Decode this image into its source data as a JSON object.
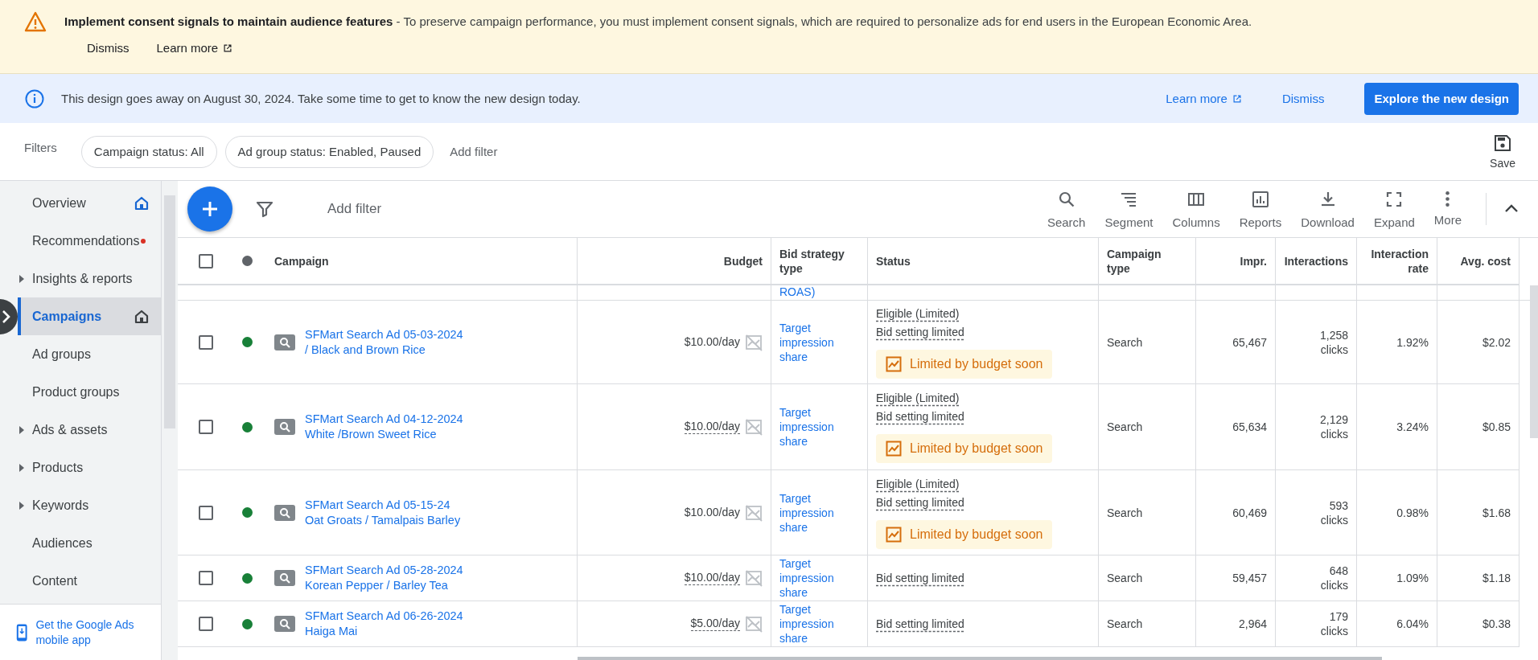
{
  "consent_banner": {
    "message": "**Implement consent signals to maintain audience features** - To preserve campaign performance, you must implement consent signals, which are required to personalize ads for end users in the European Economic Area.",
    "dismiss": "Dismiss",
    "learn_more": "Learn more"
  },
  "design_banner": {
    "message": "This design goes away on August 30, 2024. Take some time to get to know the new design today.",
    "learn_more": "Learn more",
    "dismiss": "Dismiss",
    "primary": "Explore the new design"
  },
  "filters": {
    "label": "Filters",
    "chips": [
      "Campaign status: All",
      "Ad group status: Enabled, Paused"
    ],
    "add_filter": "Add filter",
    "save": "Save"
  },
  "sidebar": {
    "items": [
      {
        "label": "Overview",
        "selected": false,
        "expandable": false,
        "notification": false,
        "home_icon": true
      },
      {
        "label": "Recommendations",
        "selected": false,
        "expandable": false,
        "notification": true,
        "home_icon": false
      },
      {
        "label": "Insights & reports",
        "selected": false,
        "expandable": true,
        "notification": false,
        "home_icon": false
      },
      {
        "label": "Campaigns",
        "selected": true,
        "expandable": false,
        "notification": false,
        "home_icon": true
      },
      {
        "label": "Ad groups",
        "selected": false,
        "expandable": false,
        "notification": false,
        "home_icon": false
      },
      {
        "label": "Product groups",
        "selected": false,
        "expandable": false,
        "notification": false,
        "home_icon": false
      },
      {
        "label": "Ads & assets",
        "selected": false,
        "expandable": true,
        "notification": false,
        "home_icon": false
      },
      {
        "label": "Products",
        "selected": false,
        "expandable": true,
        "notification": false,
        "home_icon": false
      },
      {
        "label": "Keywords",
        "selected": false,
        "expandable": true,
        "notification": false,
        "home_icon": false
      },
      {
        "label": "Audiences",
        "selected": false,
        "expandable": false,
        "notification": false,
        "home_icon": false
      },
      {
        "label": "Content",
        "selected": false,
        "expandable": false,
        "notification": false,
        "home_icon": false
      }
    ],
    "app_promo": "Get the Google Ads mobile app"
  },
  "toolbar": {
    "add_filter": "Add filter",
    "actions": [
      {
        "kind": "search",
        "label": "Search"
      },
      {
        "kind": "segment",
        "label": "Segment"
      },
      {
        "kind": "columns",
        "label": "Columns"
      },
      {
        "kind": "reports",
        "label": "Reports"
      },
      {
        "kind": "download",
        "label": "Download"
      },
      {
        "kind": "expand",
        "label": "Expand"
      },
      {
        "kind": "more",
        "label": "More"
      }
    ]
  },
  "table": {
    "columns": [
      "Campaign",
      "Budget",
      "Bid strategy type",
      "Status",
      "Campaign type",
      "Impr.",
      "Interactions",
      "Interaction rate",
      "Avg. cost"
    ],
    "select_all_checked": false,
    "partial_row": {
      "bid_strategy": "ROAS)"
    },
    "rows": [
      {
        "checked": false,
        "color": "#188038",
        "campaign": "SFMart Search Ad 05-03-2024\n/ Black and Brown Rice",
        "budget": "$10.00/day",
        "budget_dashed": false,
        "bid_strategy": "Target\nimpression\nshare",
        "statuses": [
          "Eligible (Limited)",
          "Bid setting limited"
        ],
        "badge": "Limited by budget soon",
        "type": "Search",
        "impr": "65,467",
        "interactions": "1,258\nclicks",
        "rate": "1.92%",
        "avg_cost": "$2.02"
      },
      {
        "checked": false,
        "color": "#188038",
        "campaign": "SFMart Search Ad 04-12-2024\nWhite /Brown Sweet Rice",
        "budget": "$10.00/day",
        "budget_dashed": true,
        "bid_strategy": "Target\nimpression\nshare",
        "statuses": [
          "Eligible (Limited)",
          "Bid setting limited"
        ],
        "badge": "Limited by budget soon",
        "type": "Search",
        "impr": "65,634",
        "interactions": "2,129\nclicks",
        "rate": "3.24%",
        "avg_cost": "$0.85"
      },
      {
        "checked": false,
        "color": "#188038",
        "campaign": "SFMart Search Ad 05-15-24\nOat Groats / Tamalpais Barley",
        "budget": "$10.00/day",
        "budget_dashed": false,
        "bid_strategy": "Target\nimpression\nshare",
        "statuses": [
          "Eligible (Limited)",
          "Bid setting limited"
        ],
        "badge": "Limited by budget soon",
        "type": "Search",
        "impr": "60,469",
        "interactions": "593\nclicks",
        "rate": "0.98%",
        "avg_cost": "$1.68"
      },
      {
        "checked": false,
        "color": "#188038",
        "campaign": "SFMart Search Ad 05-28-2024\nKorean Pepper / Barley Tea",
        "budget": "$10.00/day",
        "budget_dashed": true,
        "bid_strategy": "Target\nimpression\nshare",
        "statuses": [
          "Bid setting limited"
        ],
        "type": "Search",
        "impr": "59,457",
        "interactions": "648\nclicks",
        "rate": "1.09%",
        "avg_cost": "$1.18"
      },
      {
        "checked": false,
        "color": "#188038",
        "campaign": "SFMart Search Ad 06-26-2024\nHaiga Mai",
        "budget": "$5.00/day",
        "budget_dashed": true,
        "bid_strategy": "Target\nimpression\nshare",
        "statuses": [
          "Bid setting limited"
        ],
        "type": "Search",
        "impr": "2,964",
        "interactions": "179\nclicks",
        "rate": "6.04%",
        "avg_cost": "$0.38"
      }
    ]
  }
}
